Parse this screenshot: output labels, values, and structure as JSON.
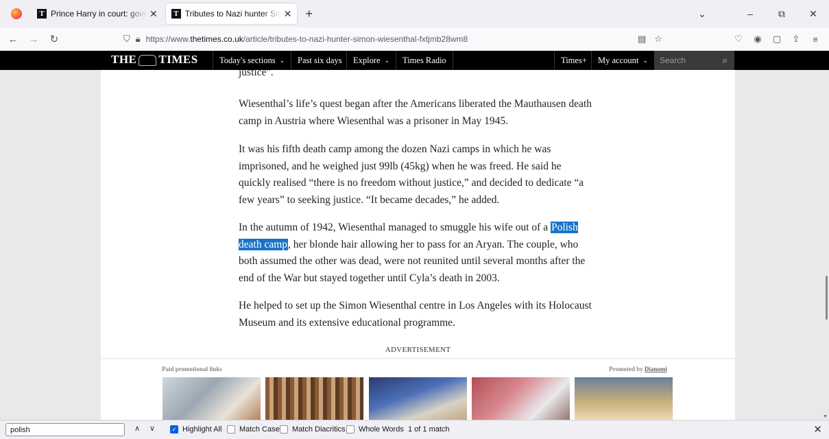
{
  "browser": {
    "tabs": [
      {
        "title": "Prince Harry in court: governme",
        "favicon": "T",
        "active": false
      },
      {
        "title": "Tributes to Nazi hunter Simon W",
        "favicon": "T",
        "active": true
      }
    ],
    "new_tab_symbol": "+",
    "url": {
      "prefix": "https://www.",
      "domain": "thetimes.co.uk",
      "path": "/article/tributes-to-nazi-hunter-simon-wiesenthal-fxtjmb28wm8"
    }
  },
  "site_nav": {
    "masthead_left": "THE",
    "masthead_right": "TIMES",
    "items": [
      "Today's sections",
      "Past six days",
      "Explore",
      "Times Radio",
      "Times+",
      "My account"
    ],
    "search_placeholder": "Search"
  },
  "article": {
    "p0": "justice\".",
    "p1": "Wiesenthal’s life’s quest began after the Americans liberated the Mauthausen death camp in Austria where Wiesenthal was a prisoner in May 1945.",
    "p2": "It was his fifth death camp among the dozen Nazi camps in which he was imprisoned, and he weighed just 99lb (45kg) when he was freed. He said he quickly realised “there is no freedom without justice,” and decided to dedicate “a few years” to seeking justice. “It became decades,” he added.",
    "p3_before": "In the autumn of 1942, Wiesenthal managed to smuggle his wife out of a ",
    "p3_highlight": "Polish death camp",
    "p3_after": ", her blonde hair allowing her to pass for an Aryan. The couple, who both assumed the other was dead, were not reunited until several months after the end of the War but stayed together until Cyla’s death in 2003.",
    "p4": "He helped to set up the Simon Wiesenthal centre in Los Angeles with its Holocaust Museum and its extensive educational programme."
  },
  "ads": {
    "label": "ADVERTISEMENT",
    "paid_label": "Paid promotional links",
    "promoted_by": "Promoted by",
    "promoter": "Dianomi"
  },
  "find_bar": {
    "query": "polish",
    "highlight_all": "Highlight All",
    "match_case": "Match Case",
    "match_diacritics": "Match Diacritics",
    "whole_words": "Whole Words",
    "match_count": "1 of 1 match",
    "highlight_all_checked": true
  },
  "colors": {
    "highlight": "#1a73c8",
    "times_nav_bg": "#000000",
    "checkbox_checked": "#0061e0"
  }
}
